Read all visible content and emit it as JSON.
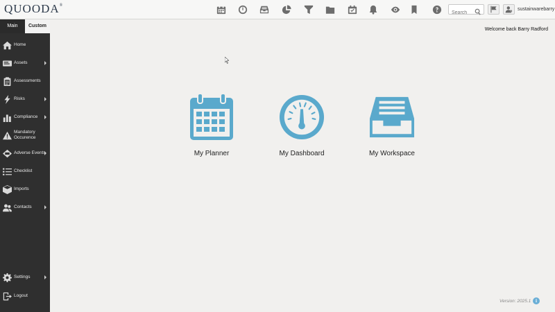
{
  "app": {
    "logo": "QUOODA",
    "logo_mark": "®"
  },
  "toolbar": {
    "icons": [
      "calendar-icon",
      "dashboard-gauge-icon",
      "inbox-icon",
      "pie-chart-icon",
      "filter-icon",
      "folder-icon",
      "checklist-icon",
      "bell-icon",
      "eye-icon",
      "bookmark-icon",
      "help-icon"
    ],
    "search_placeholder": "Search",
    "username": "sustainwarebarry"
  },
  "tabs": {
    "main": "Main",
    "custom": "Custom"
  },
  "sidebar": {
    "items": [
      {
        "label": "Home",
        "icon": "home-icon",
        "submenu": false
      },
      {
        "label": "Assets",
        "icon": "assets-icon",
        "submenu": true
      },
      {
        "label": "Assessments",
        "icon": "clipboard-icon",
        "submenu": false
      },
      {
        "label": "Risks",
        "icon": "lightning-icon",
        "submenu": true
      },
      {
        "label": "Compliance",
        "icon": "bar-chart-icon",
        "submenu": true
      },
      {
        "label": "Mandatory Occurence",
        "icon": "warning-icon",
        "submenu": false
      },
      {
        "label": "Adverse Events",
        "icon": "adverse-events-icon",
        "submenu": true
      },
      {
        "label": "Checklist",
        "icon": "list-icon",
        "submenu": false
      },
      {
        "label": "Imports",
        "icon": "box-icon",
        "submenu": false
      },
      {
        "label": "Contacts",
        "icon": "contacts-icon",
        "submenu": true
      }
    ],
    "settings": {
      "label": "Settings",
      "icon": "gear-icon",
      "submenu": true
    },
    "logout": {
      "label": "Logout",
      "icon": "logout-icon"
    }
  },
  "main": {
    "welcome": "Welcome back Barry Radford",
    "tiles": [
      {
        "label": "My Planner",
        "icon": "calendar-icon"
      },
      {
        "label": "My Dashboard",
        "icon": "dashboard-gauge-icon"
      },
      {
        "label": "My Workspace",
        "icon": "inbox-tray-icon"
      }
    ],
    "accent_color": "#5aa9cc"
  },
  "footer": {
    "version": "Version: 2025.1"
  }
}
